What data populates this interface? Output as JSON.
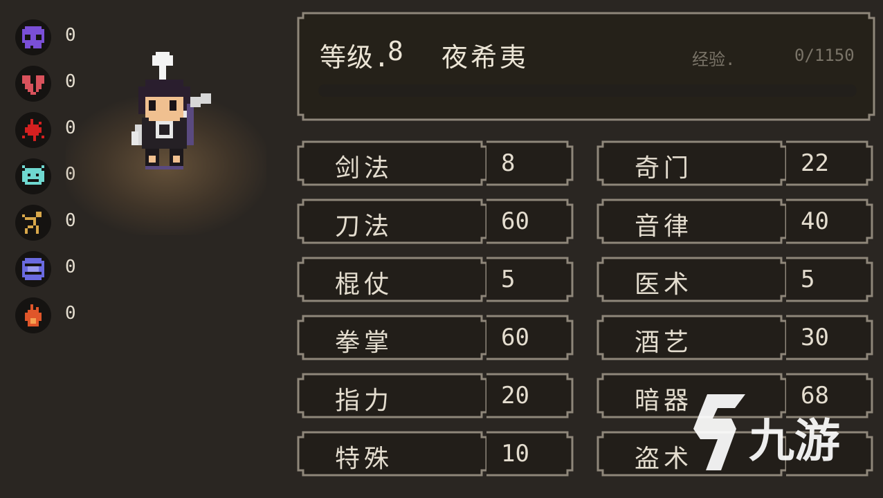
{
  "status_effects": [
    {
      "icon": "skull-icon",
      "color": "#7a4fd6",
      "value": "0"
    },
    {
      "icon": "broken-heart-icon",
      "color": "#d9525c",
      "value": "0"
    },
    {
      "icon": "blood-splatter-icon",
      "color": "#d42020",
      "value": "0"
    },
    {
      "icon": "poison-face-icon",
      "color": "#6fd8d0",
      "value": "0"
    },
    {
      "icon": "acupoint-figure-icon",
      "color": "#d9a84a",
      "value": "0"
    },
    {
      "icon": "dizzy-face-icon",
      "color": "#6a6ae0",
      "value": "0"
    },
    {
      "icon": "fire-icon",
      "color": "#e0562a",
      "value": "0"
    }
  ],
  "header": {
    "level_label": "等级.",
    "level": "8",
    "name": "夜希夷",
    "exp_label": "经验.",
    "exp_value": "0/1150",
    "exp_progress": 0
  },
  "skills_left": [
    {
      "name": "剑法",
      "value": "8"
    },
    {
      "name": "刀法",
      "value": "60"
    },
    {
      "name": "棍仗",
      "value": "5"
    },
    {
      "name": "拳掌",
      "value": "60"
    },
    {
      "name": "指力",
      "value": "20"
    },
    {
      "name": "特殊",
      "value": "10"
    }
  ],
  "skills_right": [
    {
      "name": "奇门",
      "value": "22"
    },
    {
      "name": "音律",
      "value": "40"
    },
    {
      "name": "医术",
      "value": "5"
    },
    {
      "name": "酒艺",
      "value": "30"
    },
    {
      "name": "暗器",
      "value": "68"
    },
    {
      "name": "盗术",
      "value": ""
    }
  ],
  "watermark": {
    "text": "九游",
    "icon": "nine-game-logo-icon"
  },
  "colors": {
    "background": "#2a2622",
    "frame": "#8f877a",
    "text": "#e4ddcf"
  }
}
